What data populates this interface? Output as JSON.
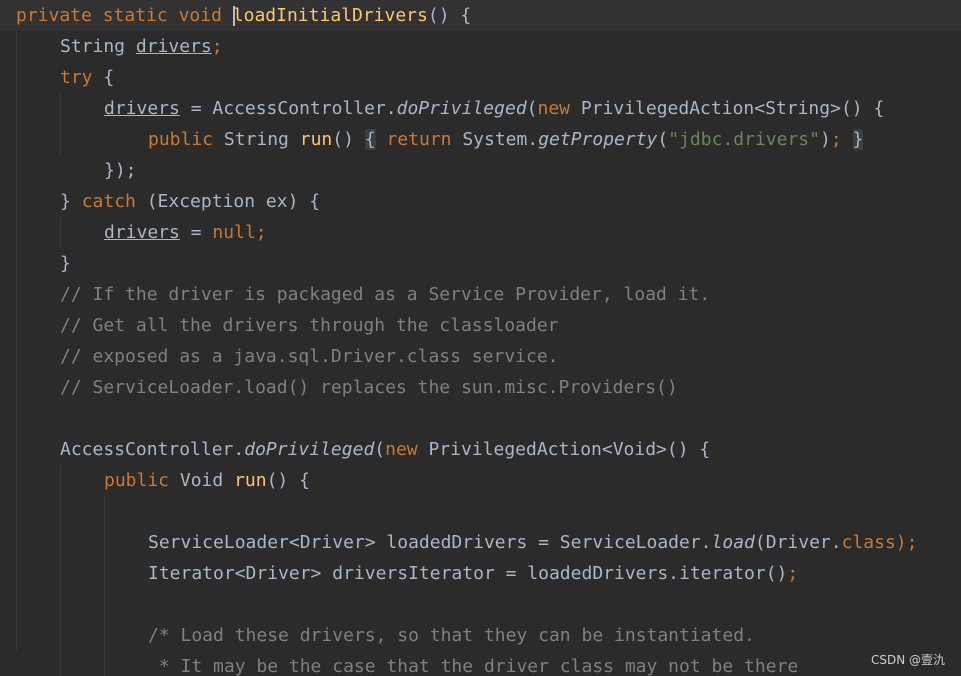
{
  "code": {
    "l1": [
      "private",
      "static",
      "void",
      "loadInitialDrivers",
      "() {"
    ],
    "l2": [
      "String",
      "drivers",
      ";"
    ],
    "l3": [
      "try",
      " {"
    ],
    "l4": [
      "drivers",
      " = AccessController.",
      "doPrivileged",
      "(",
      "new",
      " PrivilegedAction<String>() {"
    ],
    "l5": [
      "public",
      " String ",
      "run",
      "() ",
      "{",
      " ",
      "return",
      " System.",
      "getProperty",
      "(",
      "\"jdbc.drivers\"",
      ")",
      ";",
      " ",
      "}"
    ],
    "l6": [
      "});"
    ],
    "l7": [
      "} ",
      "catch",
      " (Exception ex) {"
    ],
    "l8": [
      "drivers",
      " = ",
      "null;"
    ],
    "l9": [
      "}"
    ],
    "l10": [
      "// If the driver is packaged as a Service Provider, load it."
    ],
    "l11": [
      "// Get all the drivers through the classloader"
    ],
    "l12": [
      "// exposed as a java.sql.Driver.class service."
    ],
    "l13": [
      "// ServiceLoader.load() replaces the sun.misc.Providers()"
    ],
    "l15": [
      "AccessController.",
      "doPrivileged",
      "(",
      "new",
      " PrivilegedAction<Void>() {"
    ],
    "l16": [
      "public",
      " Void ",
      "run",
      "() {"
    ],
    "l18": [
      "ServiceLoader<Driver> loadedDrivers = ServiceLoader.",
      "load",
      "(Driver.",
      "class",
      ");"
    ],
    "l19": [
      "Iterator<Driver> driversIterator = loadedDrivers.iterator()",
      ";"
    ],
    "l21": [
      "/* Load these drivers, so that they can be instantiated."
    ],
    "l22": [
      " * It may be the case that the driver class may not be there"
    ]
  },
  "watermark": "CSDN @壹氿",
  "colors": {
    "background": "#2b2b2b",
    "keyword": "#cc7832",
    "method_declaration": "#ffc66d",
    "string": "#6a8759",
    "comment": "#808080",
    "default_text": "#a9b7c6"
  }
}
